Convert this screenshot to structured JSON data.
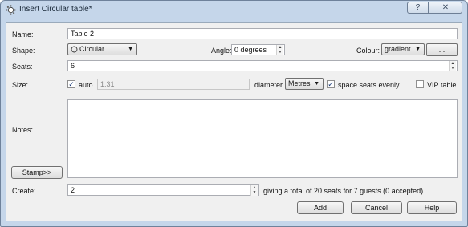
{
  "window": {
    "title": "Insert Circular table*",
    "help_glyph": "?",
    "close_glyph": "✕"
  },
  "form": {
    "name_label": "Name:",
    "name_value": "Table 2",
    "shape_label": "Shape:",
    "shape_value": "Circular",
    "angle_label": "Angle:",
    "angle_value": "0 degrees",
    "colour_label": "Colour:",
    "colour_value": "gradient",
    "colour_more_label": "...",
    "seats_label": "Seats:",
    "seats_value": "6",
    "size_label": "Size:",
    "auto_label": "auto",
    "auto_checked": true,
    "size_value": "1.31",
    "diameter_label": "diameter",
    "unit_value": "Metres",
    "space_evenly_label": "space seats evenly",
    "space_evenly_checked": true,
    "vip_label": "VIP table",
    "vip_checked": false,
    "notes_label": "Notes:",
    "notes_value": "",
    "stamp_label": "Stamp>>",
    "create_label": "Create:",
    "create_value": "2",
    "summary_text": "giving a total of 20 seats for 7 guests (0 accepted)"
  },
  "buttons": {
    "add": "Add",
    "cancel": "Cancel",
    "help": "Help"
  },
  "colors": {
    "window_frame": "#c5d6ea",
    "client_bg": "#f0f0f0",
    "check_mark": "#1d3d7a"
  }
}
